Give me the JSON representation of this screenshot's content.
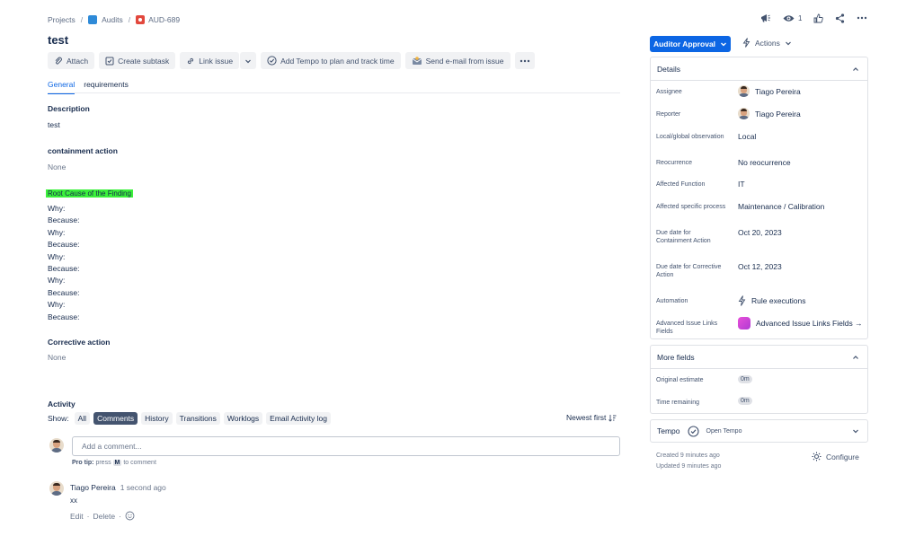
{
  "breadcrumb": {
    "projects": "Projects",
    "sep": "/",
    "project": "Audits",
    "issue_key": "AUD-689"
  },
  "issue": {
    "title": "test"
  },
  "toolbar": {
    "attach": "Attach",
    "subtask": "Create subtask",
    "link": "Link issue",
    "tempo": "Add Tempo to plan and track time",
    "email": "Send e-mail from issue"
  },
  "tabs": {
    "general": "General",
    "requirements": "requirements"
  },
  "description": {
    "heading": "Description",
    "value": "test"
  },
  "containment": {
    "heading": "containment action",
    "value": "None"
  },
  "root_cause": {
    "heading": "Root Cause of the Finding",
    "lines": [
      "Why:",
      "Because:",
      "Why:",
      "Because:",
      "Why:",
      "Because:",
      "Why:",
      "Because:",
      "Why:",
      "Because:"
    ]
  },
  "corrective": {
    "heading": "Corrective action",
    "value": "None"
  },
  "activity": {
    "heading": "Activity",
    "show_label": "Show:",
    "filters": [
      "All",
      "Comments",
      "History",
      "Transitions",
      "Worklogs",
      "Email Activity log"
    ],
    "sort": "Newest first",
    "comment_placeholder": "Add a comment...",
    "protip_label": "Pro tip:",
    "protip_press": "press",
    "protip_key": "M",
    "protip_rest": "to comment"
  },
  "comment": {
    "author": "Tiago Pereira",
    "time": "1 second ago",
    "body": "xx",
    "edit": "Edit",
    "delete": "Delete",
    "dot": "·"
  },
  "top_actions": {
    "watch_count": "1"
  },
  "status": {
    "label": "Auditor Approval"
  },
  "actions": {
    "label": "Actions"
  },
  "details": {
    "heading": "Details",
    "fields": [
      {
        "label": "Assignee",
        "value": "Tiago Pereira"
      },
      {
        "label": "Reporter",
        "value": "Tiago Pereira"
      },
      {
        "label": "Local/global observation",
        "value": "Local"
      },
      {
        "label": "Reocurrence",
        "value": "No reocurrence"
      },
      {
        "label": "Affected Function",
        "value": "IT"
      },
      {
        "label": "Affected specific process",
        "value": "Maintenance / Calibration"
      },
      {
        "label": "Due date for Containment Action",
        "value": "Oct 20, 2023"
      },
      {
        "label": "Due date for Corrective Action",
        "value": "Oct 12, 2023"
      },
      {
        "label": "Automation",
        "value": "Rule executions"
      },
      {
        "label": "Advanced Issue Links Fields",
        "value": "Advanced Issue Links Fields →"
      }
    ]
  },
  "more_fields": {
    "heading": "More fields",
    "original_label": "Original estimate",
    "original_value": "0m",
    "remaining_label": "Time remaining",
    "remaining_value": "0m"
  },
  "tempo": {
    "heading": "Tempo",
    "open": "Open Tempo"
  },
  "meta": {
    "created": "Created 9 minutes ago",
    "updated": "Updated 9 minutes ago",
    "configure": "Configure"
  },
  "colors": {
    "accent": "#0c66e4",
    "highlight": "#3bf03b",
    "issue_icon": "#e2483d",
    "project_icon": "#2e8ad8",
    "tempo_logo": "#d041d8"
  }
}
